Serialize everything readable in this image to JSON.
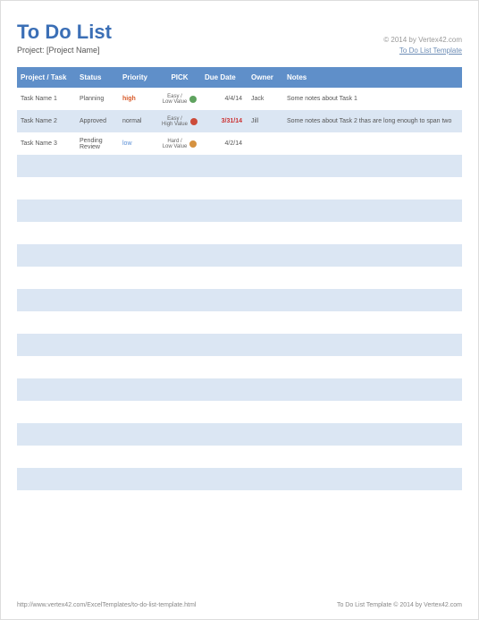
{
  "header": {
    "title": "To Do List",
    "copyright": "© 2014 by Vertex42.com",
    "project_label": "Project: [Project Name]",
    "template_link": "To Do List Template"
  },
  "columns": {
    "task": "Project / Task",
    "status": "Status",
    "priority": "Priority",
    "pick": "PICK",
    "due": "Due Date",
    "owner": "Owner",
    "notes": "Notes"
  },
  "rows": [
    {
      "task": "Task Name 1",
      "status": "Planning",
      "priority": "high",
      "priority_class": "priority-high",
      "pick": "Easy / Low Value",
      "dot": "dot-green",
      "due": "4/4/14",
      "due_class": "due-norm",
      "owner": "Jack",
      "notes": "Some notes about Task 1"
    },
    {
      "task": "Task Name 2",
      "status": "Approved",
      "priority": "normal",
      "priority_class": "priority-normal",
      "pick": "Easy / High Value",
      "dot": "dot-red",
      "due": "3/31/14",
      "due_class": "due-red",
      "owner": "Jill",
      "notes": "Some notes about Task 2 thas are long enough to span two"
    },
    {
      "task": "Task Name 3",
      "status": "Pending Review",
      "priority": "low",
      "priority_class": "priority-low",
      "pick": "Hard / Low Value",
      "dot": "dot-orange",
      "due": "4/2/14",
      "due_class": "due-norm",
      "owner": "",
      "notes": ""
    }
  ],
  "empty_row_count": 16,
  "footer": {
    "url": "http://www.vertex42.com/ExcelTemplates/to-do-list-template.html",
    "attribution": "To Do List Template © 2014 by Vertex42.com"
  }
}
